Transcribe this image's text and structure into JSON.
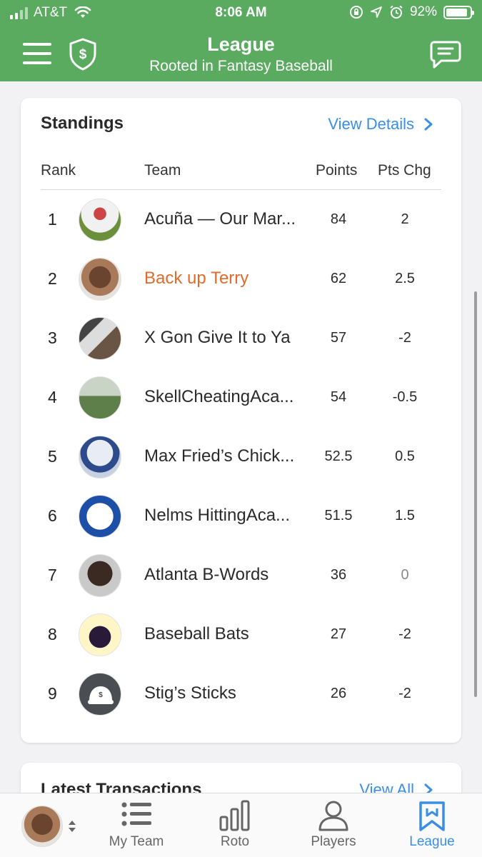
{
  "status_bar": {
    "carrier": "AT&T",
    "time": "8:06 AM",
    "battery": "92%",
    "battery_level": 0.92
  },
  "header": {
    "title": "League",
    "subtitle": "Rooted in Fantasy Baseball"
  },
  "standings": {
    "title": "Standings",
    "view_details": "View Details",
    "columns": {
      "rank": "Rank",
      "team": "Team",
      "points": "Points",
      "pts_chg": "Pts Chg"
    },
    "rows": [
      {
        "rank": "1",
        "team": "Acuña — Our Mar...",
        "points": "84",
        "pts_chg": "2"
      },
      {
        "rank": "2",
        "team": "Back up Terry",
        "points": "62",
        "pts_chg": "2.5",
        "is_mine": true
      },
      {
        "rank": "3",
        "team": "X Gon Give It to Ya",
        "points": "57",
        "pts_chg": "-2"
      },
      {
        "rank": "4",
        "team": "SkellCheatingAca...",
        "points": "54",
        "pts_chg": "-0.5"
      },
      {
        "rank": "5",
        "team": "Max Fried’s Chick...",
        "points": "52.5",
        "pts_chg": "0.5"
      },
      {
        "rank": "6",
        "team": "Nelms HittingAca...",
        "points": "51.5",
        "pts_chg": "1.5"
      },
      {
        "rank": "7",
        "team": "Atlanta B-Words",
        "points": "36",
        "pts_chg": "0"
      },
      {
        "rank": "8",
        "team": "Baseball Bats",
        "points": "27",
        "pts_chg": "-2"
      },
      {
        "rank": "9",
        "team": "Stig’s Sticks",
        "points": "26",
        "pts_chg": "-2"
      }
    ]
  },
  "transactions": {
    "title": "Latest Transactions",
    "view_all": "View All"
  },
  "tabbar": {
    "tabs": [
      {
        "label": "My Team",
        "icon": "list-icon"
      },
      {
        "label": "Roto",
        "icon": "bar-chart-icon"
      },
      {
        "label": "Players",
        "icon": "person-icon"
      },
      {
        "label": "League",
        "icon": "bookmark-icon",
        "active": true
      }
    ]
  },
  "colors": {
    "header_green": "#5aab5f",
    "link_blue": "#3a8ee6",
    "my_team_orange": "#e06b2c"
  }
}
